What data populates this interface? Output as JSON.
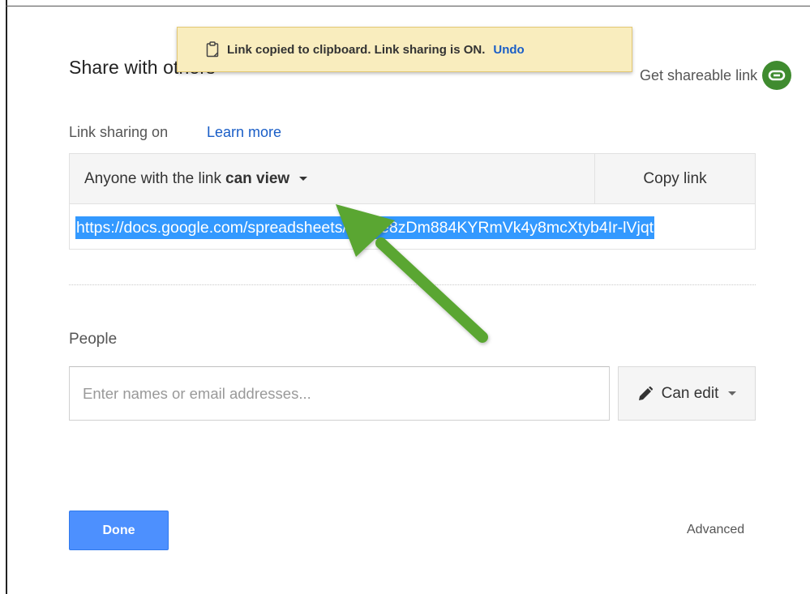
{
  "dialog": {
    "title": "Share with others",
    "shareable_link_label": "Get shareable link"
  },
  "toast": {
    "icon": "clipboard-icon",
    "message": "Link copied to clipboard. Link sharing is ON.",
    "undo_label": "Undo"
  },
  "link_sharing": {
    "status_label": "Link sharing on",
    "learn_more_label": "Learn more",
    "access_prefix": "Anyone with the link",
    "access_level": "can view",
    "copy_link_label": "Copy link",
    "url": "https://docs.google.com/spreadsheets/d/1He8zDm884KYRmVk4y8mcXtyb4Ir-lVjqt"
  },
  "people": {
    "label": "People",
    "input_placeholder": "Enter names or email addresses...",
    "permission_label": "Can edit"
  },
  "footer": {
    "done_label": "Done",
    "advanced_label": "Advanced"
  },
  "colors": {
    "link_badge": "#3f8b2f",
    "toast_bg": "#f9edbe",
    "done_button": "#4d90fe",
    "annotation_arrow": "#5aa632",
    "url_highlight": "#3399ff"
  }
}
